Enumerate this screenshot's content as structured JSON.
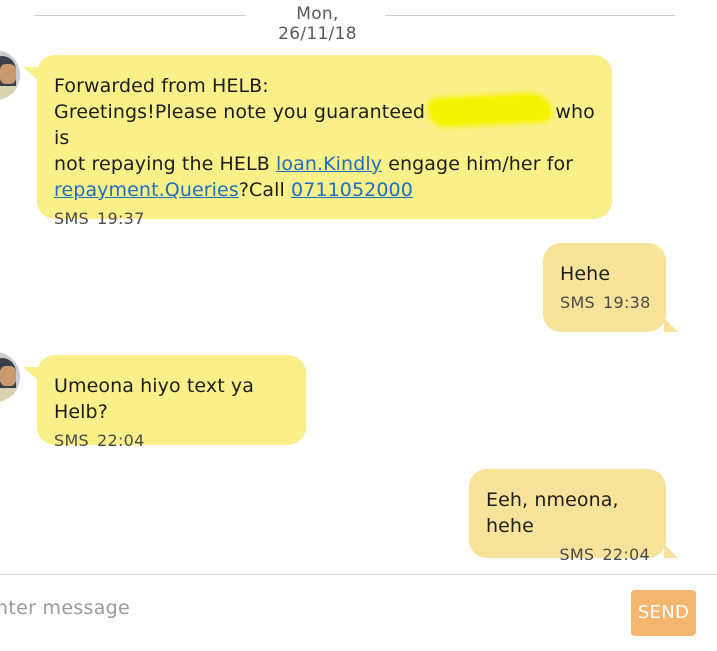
{
  "thread": {
    "date_separator": "Mon, 26/11/18"
  },
  "messages": [
    {
      "direction": "incoming",
      "line1": "Forwarded from HELB:",
      "line2_pre": "Greetings!Please note you guaranteed ",
      "line2_post": " who is",
      "line3_pre": "not repaying the HELB ",
      "line3_link": "loan.Kindly",
      "line3_post": " engage him/her for",
      "line4_link": "repayment.Queries",
      "line4_mid": "?Call ",
      "line4_phone": "0711052000",
      "type": "SMS",
      "time": "19:37"
    },
    {
      "direction": "outgoing",
      "text": "Hehe",
      "type": "SMS",
      "time": "19:38"
    },
    {
      "direction": "incoming",
      "text": "Umeona hiyo text ya Helb?",
      "type": "SMS",
      "time": "22:04"
    },
    {
      "direction": "outgoing",
      "text": "Eeh, nmeona, hehe",
      "type": "SMS",
      "time": "22:04"
    }
  ],
  "composer": {
    "placeholder": "nter message",
    "send_label": "SEND"
  },
  "colors": {
    "incoming_bubble": "#faf08a",
    "outgoing_bubble": "#f8e39a",
    "link": "#1f6fc0",
    "send_button": "#f5b66f"
  }
}
